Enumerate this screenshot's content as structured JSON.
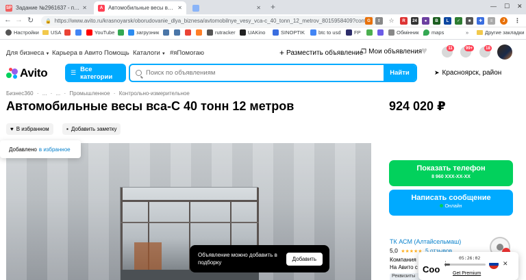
{
  "browser": {
    "tabs": [
      {
        "favicon": "SP",
        "label": "Задание №2961637 - просмотр з"
      },
      {
        "favicon": "A",
        "label": "Автомобильные весы вса-С 40 т"
      },
      {
        "favicon": "",
        "label": ""
      }
    ],
    "new_tab": "+",
    "url": "https://www.avito.ru/krasnoyarsk/oborudovanie_dlya_biznesa/avtomobilnye_vesy_vca-c_40_tonn_12_metrov_8015958409?cont..."
  },
  "bookmarks": [
    {
      "label": "Настройки",
      "color": "#555555"
    },
    {
      "label": "USA",
      "color": "#f2c94c",
      "folder": true
    },
    {
      "label": "",
      "color": "#ea4335"
    },
    {
      "label": "",
      "color": "#4285f4"
    },
    {
      "label": "YouTube",
      "color": "#ff0000"
    },
    {
      "label": "",
      "color": "#34a853"
    },
    {
      "label": "загрузник",
      "color": "#2d8cf0"
    },
    {
      "label": "",
      "color": "#4a76a8"
    },
    {
      "label": "",
      "color": "#4a76a8"
    },
    {
      "label": "",
      "color": "#ea4335"
    },
    {
      "label": "",
      "color": "#ff7f27"
    },
    {
      "label": "rutracker",
      "color": "#555555"
    },
    {
      "label": "UAKino",
      "color": "#222222"
    },
    {
      "label": "SINOPTIK",
      "color": "#3a6ee0"
    },
    {
      "label": "btc to usd",
      "color": "#4285f4"
    },
    {
      "label": "FP",
      "color": "#2d2d6a"
    },
    {
      "label": "",
      "color": "#4caf50"
    },
    {
      "label": "",
      "color": "#6c5ce7"
    },
    {
      "label": "Обмінник",
      "color": "#888888"
    },
    {
      "label": "maps",
      "color": "#34a853"
    },
    {
      "label": "Другие закладки",
      "color": "#f2c94c",
      "folder": true
    }
  ],
  "header": {
    "nav": [
      {
        "label": "Для бизнеса",
        "dropdown": true
      },
      {
        "label": "Карьера в Авито",
        "dropdown": false
      },
      {
        "label": "Помощь",
        "dropdown": false
      },
      {
        "label": "Каталоги",
        "dropdown": true
      },
      {
        "label": "#яПомогаю",
        "dropdown": false
      }
    ],
    "post_ad": "Разместить объявление",
    "my_ads": "Мои объявления",
    "badges": {
      "notifications": "11",
      "messages": "99+",
      "cart": "18"
    }
  },
  "search": {
    "logo": "Avito",
    "categories_button": "Все категории",
    "placeholder": "Поиск по объявлениям",
    "find_button": "Найти",
    "location": "Красноярск, район"
  },
  "listing": {
    "breadcrumbs": [
      "Бизнес360",
      "·",
      "...",
      "·",
      "...",
      "·",
      "Промышленное",
      "·",
      "Контрольно-измерительное"
    ],
    "title": "Автомобильные весы вса-С 40 тонн 12 метров",
    "price": "924 020 ₽",
    "favorite_button": "В избранном",
    "note_button": "Добавить заметку",
    "toast": {
      "text": "Добавлено",
      "link": "в избранное"
    },
    "overlay_tip": {
      "text": "Объявление можно добавить в подборку",
      "button": "Добавить"
    }
  },
  "sidebar": {
    "phone_button": "Показать телефон",
    "phone_number": "8 960 XXX-XX-XX",
    "message_button": "Написать сообщение",
    "online_status": "Онлайн",
    "seller_name": "ТК АСМ (Алтайсельмаш)",
    "rating_value": "5,0",
    "reviews": "5 отзывов",
    "company_label": "Компания",
    "on_avito": "На Авито с",
    "requisites": "Реквизиты"
  },
  "player": {
    "time": "05:26:02",
    "label": "Get Premium",
    "ghost_text": "Coo"
  },
  "colors": {
    "accent": "#00aaff",
    "green": "#02d15c",
    "badge": "#ff4053",
    "link": "#0a82cc"
  }
}
